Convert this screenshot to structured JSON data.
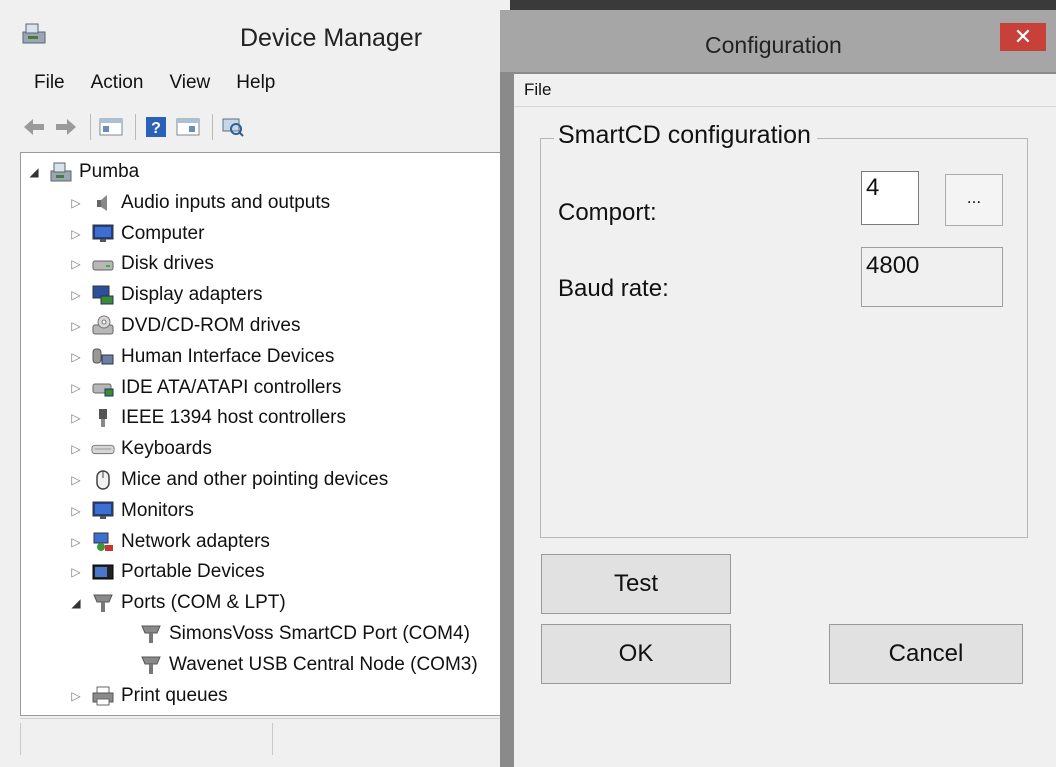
{
  "device_manager": {
    "title": "Device Manager",
    "menu": [
      "File",
      "Action",
      "View",
      "Help"
    ],
    "tree": [
      {
        "label": "Pumba",
        "expanded": true,
        "icon": "computer-root-icon",
        "level": 0
      },
      {
        "label": "Audio inputs and outputs",
        "expanded": false,
        "icon": "speaker-icon",
        "level": 1
      },
      {
        "label": "Computer",
        "expanded": false,
        "icon": "monitor-icon",
        "level": 1
      },
      {
        "label": "Disk drives",
        "expanded": false,
        "icon": "disk-drive-icon",
        "level": 1
      },
      {
        "label": "Display adapters",
        "expanded": false,
        "icon": "display-adapter-icon",
        "level": 1
      },
      {
        "label": "DVD/CD-ROM drives",
        "expanded": false,
        "icon": "dvd-drive-icon",
        "level": 1
      },
      {
        "label": "Human Interface Devices",
        "expanded": false,
        "icon": "hid-icon",
        "level": 1
      },
      {
        "label": "IDE ATA/ATAPI controllers",
        "expanded": false,
        "icon": "ide-controller-icon",
        "level": 1
      },
      {
        "label": "IEEE 1394 host controllers",
        "expanded": false,
        "icon": "firewire-icon",
        "level": 1
      },
      {
        "label": "Keyboards",
        "expanded": false,
        "icon": "keyboard-icon",
        "level": 1
      },
      {
        "label": "Mice and other pointing devices",
        "expanded": false,
        "icon": "mouse-icon",
        "level": 1
      },
      {
        "label": "Monitors",
        "expanded": false,
        "icon": "monitor-icon",
        "level": 1
      },
      {
        "label": "Network adapters",
        "expanded": false,
        "icon": "network-adapter-icon",
        "level": 1
      },
      {
        "label": "Portable Devices",
        "expanded": false,
        "icon": "portable-device-icon",
        "level": 1
      },
      {
        "label": "Ports (COM & LPT)",
        "expanded": true,
        "icon": "port-icon",
        "level": 1
      },
      {
        "label": "SimonsVoss SmartCD Port (COM4)",
        "expanded": null,
        "icon": "port-icon",
        "level": 2
      },
      {
        "label": "Wavenet USB Central Node (COM3)",
        "expanded": null,
        "icon": "port-icon",
        "level": 2
      },
      {
        "label": "Print queues",
        "expanded": false,
        "icon": "printer-icon",
        "level": 1
      }
    ]
  },
  "config": {
    "title": "Configuration",
    "close_glyph": "✕",
    "menu_file": "File",
    "group_title": "SmartCD configuration",
    "comport_label": "Comport:",
    "comport_value": "4",
    "browse_label": "...",
    "baud_label": "Baud rate:",
    "baud_value": "4800",
    "test_label": "Test",
    "ok_label": "OK",
    "cancel_label": "Cancel"
  },
  "colors": {
    "close_button": "#c8403a",
    "dialog_frame": "#8a8a8a",
    "window_bg": "#f0f0f0"
  }
}
